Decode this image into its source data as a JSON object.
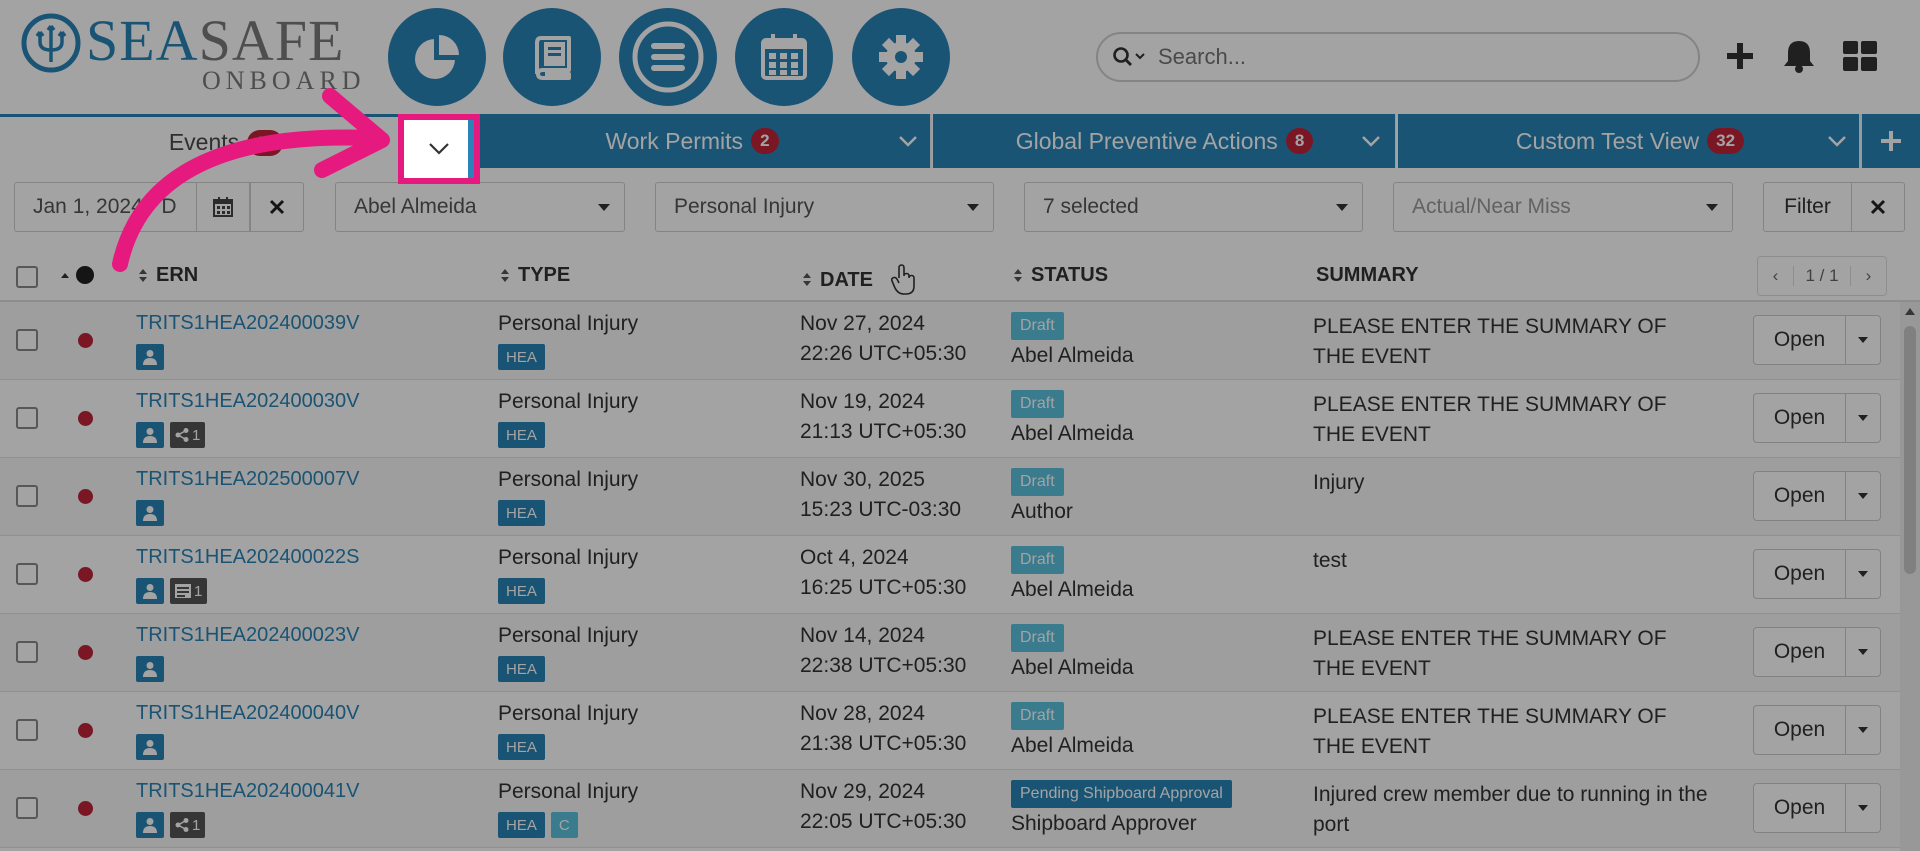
{
  "header": {
    "logo_main_a": "SEA",
    "logo_main_b": "SAFE",
    "logo_sub": "ONBOARD",
    "nav": [
      {
        "name": "dashboard-icon"
      },
      {
        "name": "book-icon"
      },
      {
        "name": "menu-icon"
      },
      {
        "name": "calendar-icon"
      },
      {
        "name": "gear-icon"
      }
    ],
    "search_placeholder": "Search...",
    "right_icons": [
      "plus-icon",
      "bell-icon",
      "grid-icon"
    ]
  },
  "tabs": [
    {
      "label": "Events",
      "badge": "11",
      "active": true
    },
    {
      "label": "Work Permits",
      "badge": "2"
    },
    {
      "label": "Global Preventive Actions",
      "badge": "8"
    },
    {
      "label": "Custom Test View",
      "badge": "32"
    }
  ],
  "filters": {
    "date": "Jan 1, 2024 - D",
    "person": "Abel Almeida",
    "type": "Personal Injury",
    "selected": "7 selected",
    "actual_placeholder": "Actual/Near Miss",
    "filter_label": "Filter"
  },
  "columns": {
    "ern": "ERN",
    "type": "TYPE",
    "date": "DATE",
    "status": "STATUS",
    "summary": "SUMMARY"
  },
  "pager": {
    "text": "1 / 1"
  },
  "rows": [
    {
      "ern": "TRITS1HEA202400039V",
      "extra": "",
      "type": "Personal Injury",
      "tags": [
        "HEA"
      ],
      "date1": "Nov 27, 2024",
      "date2": "22:26 UTC+05:30",
      "status": "Draft",
      "by": "Abel Almeida",
      "summary": "PLEASE ENTER THE SUMMARY OF THE EVENT"
    },
    {
      "ern": "TRITS1HEA202400030V",
      "extra": "share",
      "type": "Personal Injury",
      "tags": [
        "HEA"
      ],
      "date1": "Nov 19, 2024",
      "date2": "21:13 UTC+05:30",
      "status": "Draft",
      "by": "Abel Almeida",
      "summary": "PLEASE ENTER THE SUMMARY OF THE EVENT"
    },
    {
      "ern": "TRITS1HEA202500007V",
      "extra": "",
      "type": "Personal Injury",
      "tags": [
        "HEA"
      ],
      "date1": "Nov 30, 2025",
      "date2": "15:23 UTC-03:30",
      "status": "Draft",
      "by": "Author",
      "summary": "Injury"
    },
    {
      "ern": "TRITS1HEA202400022S",
      "extra": "list",
      "type": "Personal Injury",
      "tags": [
        "HEA"
      ],
      "date1": "Oct 4, 2024",
      "date2": "16:25 UTC+05:30",
      "status": "Draft",
      "by": "Abel Almeida",
      "summary": "test"
    },
    {
      "ern": "TRITS1HEA202400023V",
      "extra": "",
      "type": "Personal Injury",
      "tags": [
        "HEA"
      ],
      "date1": "Nov 14, 2024",
      "date2": "22:38 UTC+05:30",
      "status": "Draft",
      "by": "Abel Almeida",
      "summary": "PLEASE ENTER THE SUMMARY OF THE EVENT"
    },
    {
      "ern": "TRITS1HEA202400040V",
      "extra": "",
      "type": "Personal Injury",
      "tags": [
        "HEA"
      ],
      "date1": "Nov 28, 2024",
      "date2": "21:38 UTC+05:30",
      "status": "Draft",
      "by": "Abel Almeida",
      "summary": "PLEASE ENTER THE SUMMARY OF THE EVENT"
    },
    {
      "ern": "TRITS1HEA202400041V",
      "extra": "share",
      "type": "Personal Injury",
      "tags": [
        "HEA",
        "C"
      ],
      "date1": "Nov 29, 2024",
      "date2": "22:05 UTC+05:30",
      "status": "Pending Shipboard Approval",
      "by": "Shipboard Approver",
      "summary": "Injured crew member due to running in the port"
    }
  ],
  "badge_count": "1",
  "open_label": "Open",
  "colors": {
    "brand": "#2a84b8",
    "accent": "#e6197e",
    "danger": "#c0253a",
    "draft": "#5bc0de"
  }
}
